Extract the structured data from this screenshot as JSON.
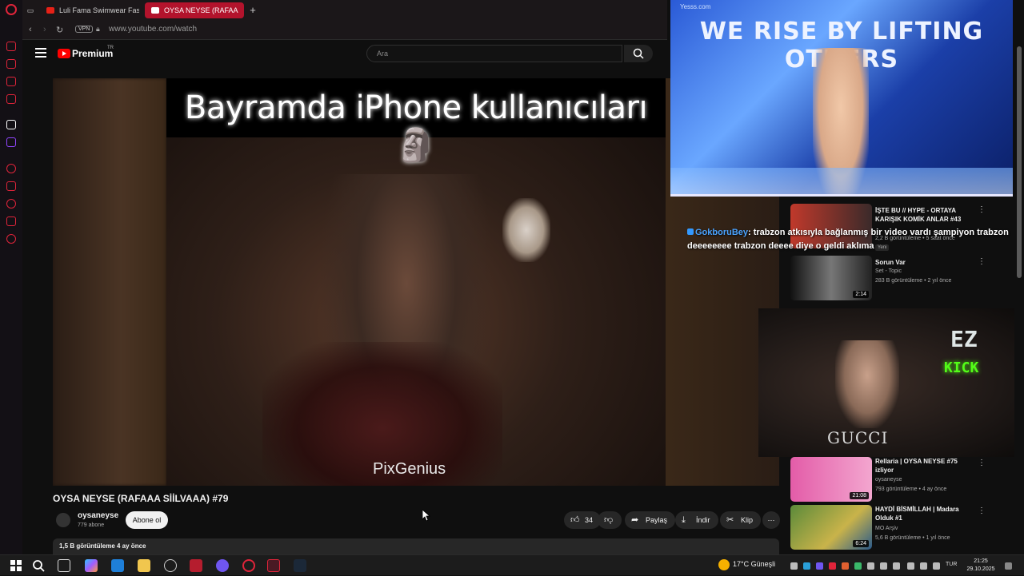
{
  "browser": {
    "tabs": [
      {
        "label": "Luli Fama Swimwear Fash"
      },
      {
        "label": "OYSA NEYSE (RAFAA"
      }
    ],
    "vpn_label": "VPN",
    "url": "www.youtube.com/watch"
  },
  "youtube": {
    "brand": "Premium",
    "brand_suffix": "TR",
    "search_placeholder": "Ara"
  },
  "video": {
    "caption": "Bayramda iPhone kullanıcıları 🗿",
    "watermark": "PixGenius",
    "title": "OYSA NEYSE (RAFAAA SİİLVAAA) #79",
    "channel": "oysaneyse",
    "subscribers": "779 abone",
    "subscribe_label": "Abone ol",
    "likes": "34",
    "share_label": "Paylaş",
    "download_label": "İndir",
    "clip_label": "Klip",
    "description_meta": "1,5 B görüntüleme  4 ay önce"
  },
  "recommendations": [
    {
      "title": "İŞTE BU // HYPE - ORTAYA KARIŞIK KOMİK ANLAR #43",
      "meta": "2,2 B görüntüleme • 5 saat önce",
      "badge": "Yeni"
    },
    {
      "title": "Sorun Var",
      "channel": "Set - Topic",
      "meta": "283 B görüntüleme • 2 yıl önce",
      "duration": "2:14"
    },
    {
      "title": "Rellaria | OYSA NEYSE #75 izliyor",
      "channel": "oysaneyse",
      "meta": "793 görüntüleme • 4 ay önce",
      "duration": "21:08"
    },
    {
      "title": "HAYDİ BİSMİLLAH | Madara Olduk #1",
      "channel": "MO Arşiv",
      "meta": "5,6 B görüntüleme • 1 yıl önce",
      "duration": "6:24"
    }
  ],
  "overlay": {
    "slogan": "WE RISE BY LIFTING OTHERS",
    "site": "Yesss.com",
    "chat_user": "GokboruBey",
    "chat_text": ": trabzon atkısıyla bağlanmış bir video vardı şampiyon trabzon deeeeeeee trabzon deeee diye o geldi aklıma",
    "webcam_shirt": "GUCCI",
    "logo_ez": "EZ",
    "logo_kick": "KICK"
  },
  "taskbar": {
    "weather": "17°C  Güneşli",
    "language": "TUR",
    "time": "21:25",
    "date": "29.10.2025"
  },
  "colors": {
    "opera_red": "#e0243a",
    "yt_red": "#ff0000",
    "kick_green": "#53fc18"
  }
}
